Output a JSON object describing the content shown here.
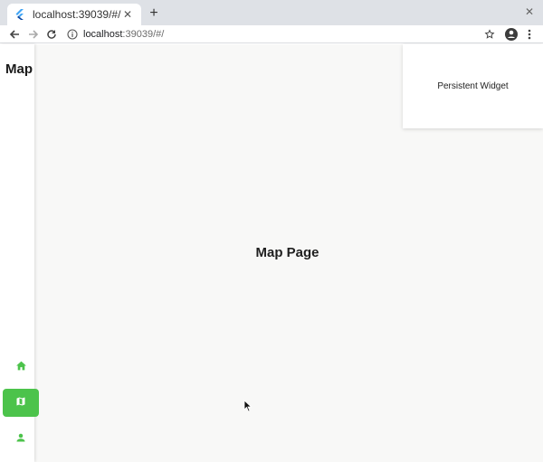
{
  "browser": {
    "tab_title": "localhost:39039/#/",
    "url_host": "localhost",
    "url_rest": ":39039/#/",
    "icons": {
      "favicon": "flutter-icon",
      "tab_close": "close-icon",
      "new_tab": "plus-icon",
      "window_close": "close-icon",
      "back": "back-arrow-icon",
      "forward": "forward-arrow-icon",
      "reload": "reload-icon",
      "site_info": "info-icon",
      "bookmark": "star-icon",
      "profile": "account-icon",
      "menu": "more-vert-icon"
    }
  },
  "app": {
    "rail_title": "Map",
    "page_title": "Map Page",
    "persistent_widget": "Persistent Widget",
    "nav": [
      {
        "name": "home",
        "icon": "home-icon",
        "selected": false
      },
      {
        "name": "map",
        "icon": "map-icon",
        "selected": true
      },
      {
        "name": "profile",
        "icon": "person-icon",
        "selected": false
      }
    ],
    "colors": {
      "accent": "#4cc34b",
      "background": "#f8f8f7"
    }
  }
}
